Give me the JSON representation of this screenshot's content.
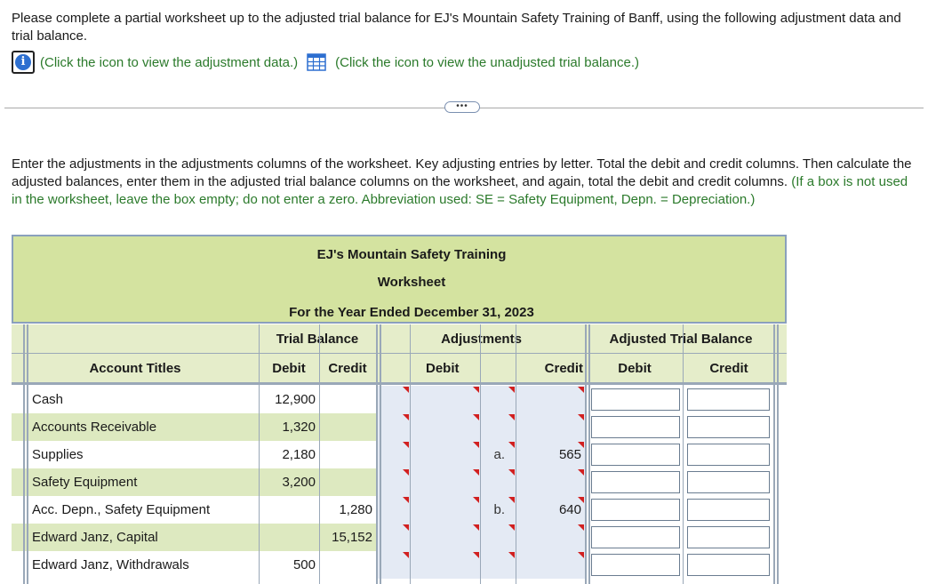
{
  "intro": {
    "text": "Please complete a partial worksheet up to the adjusted trial balance for EJ's Mountain Safety Training of Banff, using the following adjustment data and trial balance.",
    "link_adjustment": "(Click the icon to view the adjustment data.)",
    "link_trial_balance": "(Click the icon to view the unadjusted trial balance.)"
  },
  "expander_label": "•••",
  "instructions": {
    "text": "Enter the adjustments in the adjustments columns of the worksheet. Key adjusting entries by letter. Total the debit and credit columns. Then calculate the adjusted balances, enter them in the adjusted trial balance columns on the worksheet, and again, total the debit and credit columns.",
    "note": "(If a box is not used in the worksheet, leave the box empty; do not enter a zero. Abbreviation used: SE = Safety Equipment, Depn. = Depreciation.)"
  },
  "worksheet": {
    "company": "EJ's Mountain Safety Training",
    "title": "Worksheet",
    "period": "For the Year Ended December 31, 2023",
    "groups": {
      "trial_balance": "Trial Balance",
      "adjustments": "Adjustments",
      "adjusted": "Adjusted Trial Balance"
    },
    "cols": {
      "account_titles": "Account Titles",
      "debit": "Debit",
      "credit": "Credit"
    },
    "rows": [
      {
        "account": "Cash",
        "tb_debit": "12,900",
        "tb_credit": "",
        "adj_debit_letter": "",
        "adj_debit": "",
        "adj_credit_letter": "",
        "adj_credit": ""
      },
      {
        "account": "Accounts Receivable",
        "tb_debit": "1,320",
        "tb_credit": "",
        "adj_debit_letter": "",
        "adj_debit": "",
        "adj_credit_letter": "",
        "adj_credit": ""
      },
      {
        "account": "Supplies",
        "tb_debit": "2,180",
        "tb_credit": "",
        "adj_debit_letter": "",
        "adj_debit": "",
        "adj_credit_letter": "a.",
        "adj_credit": "565"
      },
      {
        "account": "Safety Equipment",
        "tb_debit": "3,200",
        "tb_credit": "",
        "adj_debit_letter": "",
        "adj_debit": "",
        "adj_credit_letter": "",
        "adj_credit": ""
      },
      {
        "account": "Acc. Depn., Safety Equipment",
        "tb_debit": "",
        "tb_credit": "1,280",
        "adj_debit_letter": "",
        "adj_debit": "",
        "adj_credit_letter": "b.",
        "adj_credit": "640"
      },
      {
        "account": "Edward Janz, Capital",
        "tb_debit": "",
        "tb_credit": "15,152",
        "adj_debit_letter": "",
        "adj_debit": "",
        "adj_credit_letter": "",
        "adj_credit": ""
      },
      {
        "account": "Edward Janz, Withdrawals",
        "tb_debit": "500",
        "tb_credit": "",
        "adj_debit_letter": "",
        "adj_debit": "",
        "adj_credit_letter": "",
        "adj_credit": ""
      }
    ]
  },
  "colors": {
    "accent_green": "#2b7a2b",
    "title_bg": "#d4e3a0",
    "header_bg": "#e5edca",
    "row_alt": "#dde9c0",
    "adj_bg": "#e4eaf4",
    "flag_red": "#d12020"
  }
}
